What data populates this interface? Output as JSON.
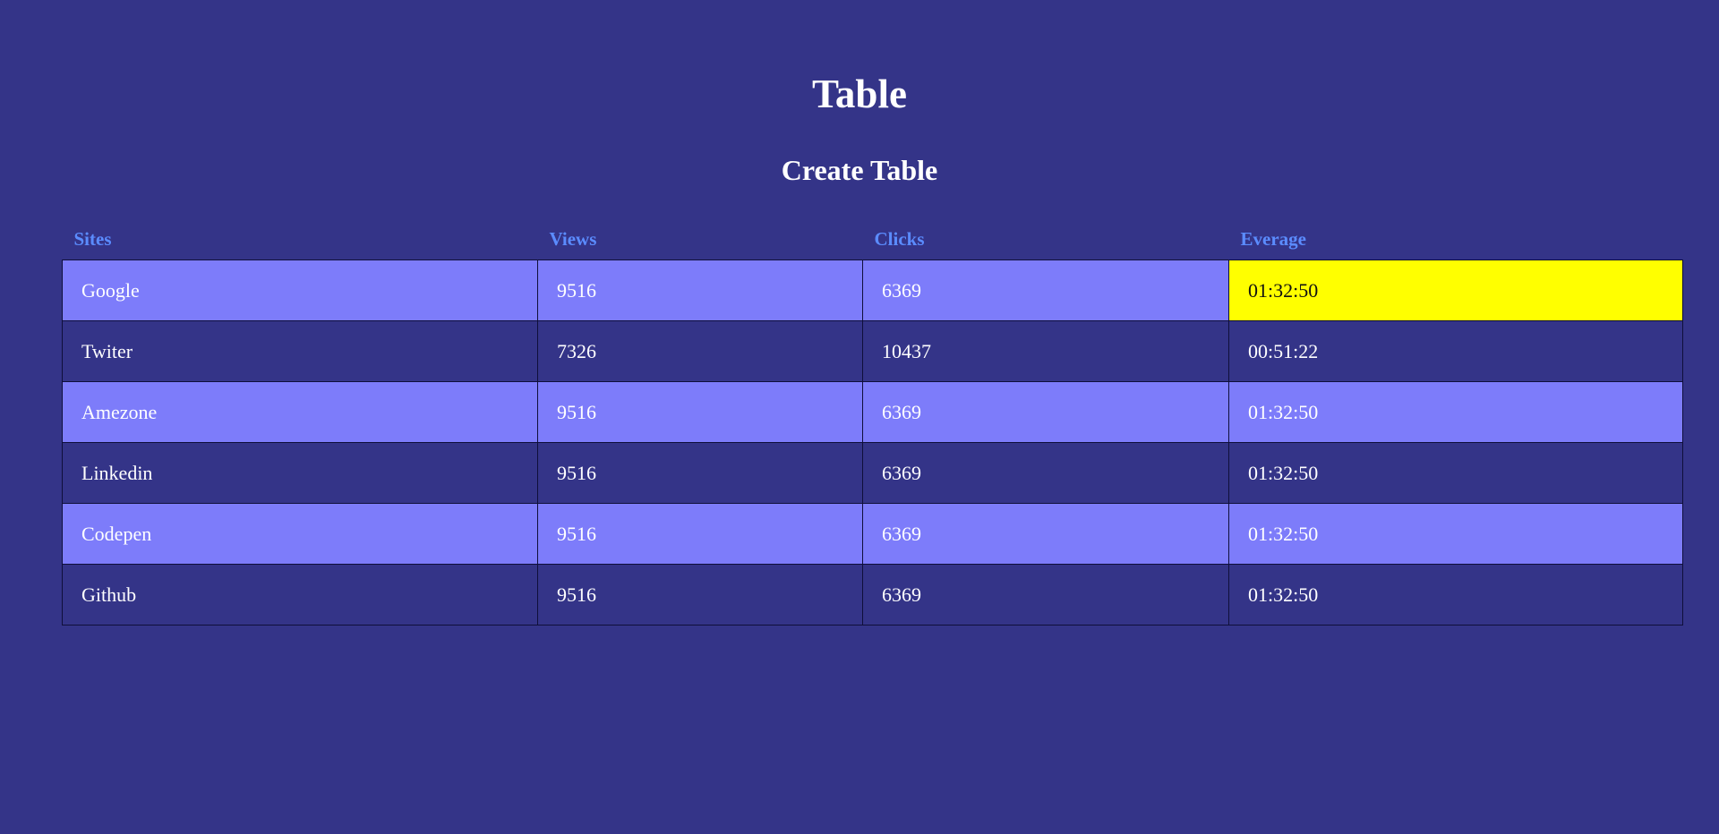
{
  "page": {
    "title": "Table",
    "subtitle": "Create Table"
  },
  "table": {
    "headers": [
      "Sites",
      "Views",
      "Clicks",
      "Everage"
    ],
    "rows": [
      {
        "site": "Google",
        "views": "9516",
        "clicks": "6369",
        "average": "01:32:50"
      },
      {
        "site": "Twiter",
        "views": "7326",
        "clicks": "10437",
        "average": "00:51:22"
      },
      {
        "site": "Amezone",
        "views": "9516",
        "clicks": "6369",
        "average": "01:32:50"
      },
      {
        "site": "Linkedin",
        "views": "9516",
        "clicks": "6369",
        "average": "01:32:50"
      },
      {
        "site": "Codepen",
        "views": "9516",
        "clicks": "6369",
        "average": "01:32:50"
      },
      {
        "site": "Github",
        "views": "9516",
        "clicks": "6369",
        "average": "01:32:50"
      }
    ]
  },
  "colors": {
    "background": "#343488",
    "row_alt": "#7d7cfa",
    "header_text": "#5b8cff",
    "highlight": "#ffff00"
  }
}
